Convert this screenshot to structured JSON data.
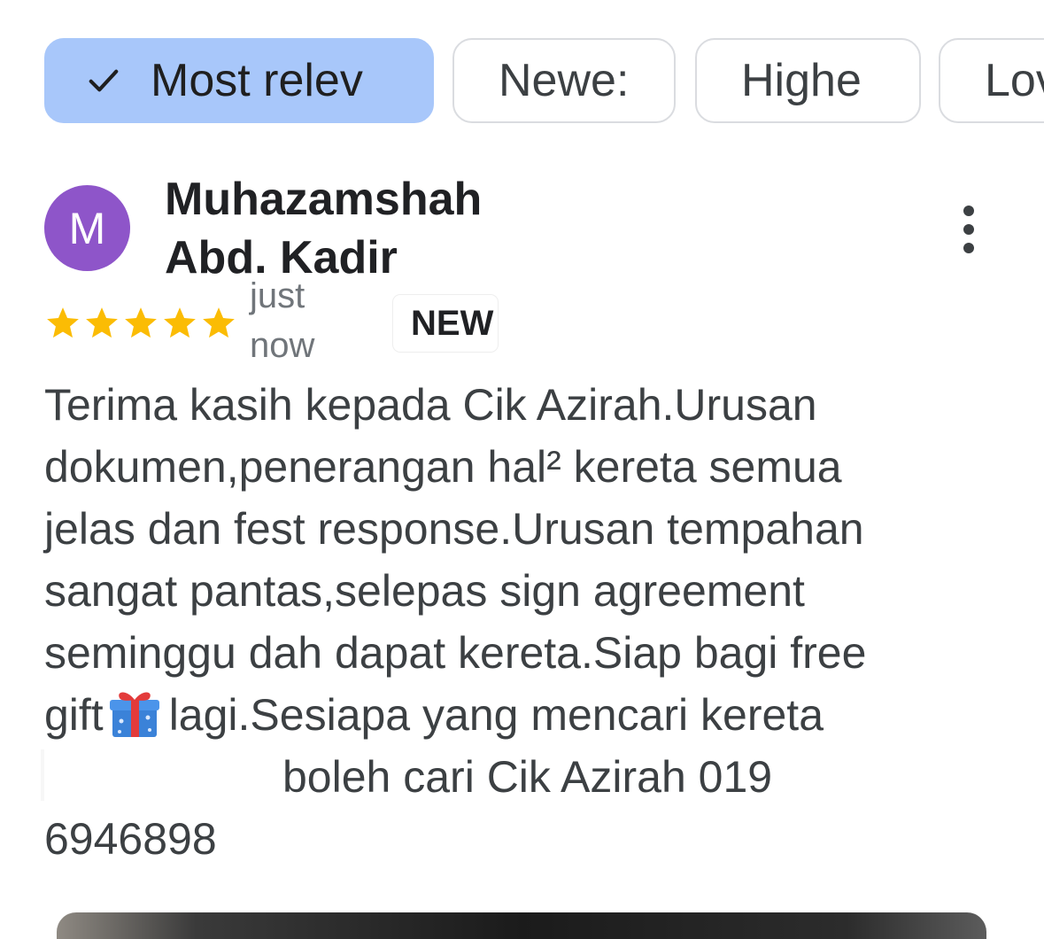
{
  "filters": {
    "chips": [
      {
        "label": "Most relev",
        "selected": true
      },
      {
        "label": "Newe:",
        "selected": false
      },
      {
        "label": "Highe",
        "selected": false
      },
      {
        "label": "Lov",
        "selected": false
      }
    ]
  },
  "review": {
    "avatar_letter": "M",
    "avatar_color": "#8e55c9",
    "author_line1": "Muhazamshah",
    "author_line2": "Abd. Kadir",
    "rating": 5,
    "rating_max": 5,
    "star_color": "#fbbc04",
    "time_line1": "just",
    "time_line2": "now",
    "badge": "NEW",
    "text_lines": [
      "Terima kasih kepada Cik Azirah.Urusan",
      "dokumen,penerangan hal² kereta semua",
      "jelas dan fest response.Urusan tempahan",
      "sangat pantas,selepas sign agreement",
      "seminggu dah dapat kereta.Siap bagi free"
    ],
    "line6_before_icon": "gift",
    "line6_icon": "gift-emoji-icon",
    "line6_after_icon": "lagi.Sesiapa yang mencari kereta",
    "line7_after_redaction": "boleh cari Cik Azirah 019",
    "line8": "6946898"
  },
  "colors": {
    "selected_chip": "#a8c7fa",
    "chip_border": "#dadce0"
  }
}
